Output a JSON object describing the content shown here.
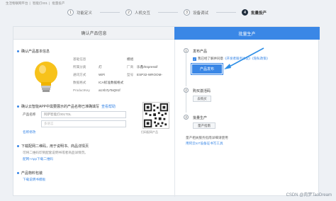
{
  "breadcrumb": [
    "生活物联网平台",
    "智能灯001",
    "批量投产"
  ],
  "steps": [
    {
      "num": "1",
      "label": "功能定义"
    },
    {
      "num": "2",
      "label": "人机交互"
    },
    {
      "num": "3",
      "label": "设备调试"
    },
    {
      "num": "4",
      "label": "批量投产"
    }
  ],
  "left_header": "确认产品信息",
  "right_header": "批量生产",
  "product_section_title": "确认产品基本信息",
  "product_info": [
    {
      "k": "基础信息",
      "v": "模组"
    },
    {
      "k": "所属分类",
      "v": "灯"
    },
    {
      "k": "厂商",
      "v": "乐鑫/Espressif"
    },
    {
      "k": "通讯方式",
      "v": "WiFi"
    },
    {
      "k": "型号",
      "v": "ESP32-WROOM-"
    },
    {
      "k": "数据格式",
      "v": "ICA标准数据格式"
    },
    {
      "k": "ProductKey",
      "v": "a1Xb7pTaQ91f"
    }
  ],
  "app_section": {
    "title": "确认云智能APP中需要展示的产品名称已准确填写",
    "link": "查看帮助",
    "product_name_label": "产品名称",
    "product_name_value": "阿萨智能灯001TDL",
    "subname_placeholder": "多语言",
    "rename_link": "名称修改",
    "qr_label": "扫码配网产品"
  },
  "download_section": {
    "title": "下载配网二维码，用于说明书、商品详情页",
    "desc": "可将二维码印到配套说明书或者商品详情页。",
    "links": "配网+App下载二维码"
  },
  "material_section": {
    "title": "产品物料包装",
    "link": "下载说明书模板"
  },
  "publish": {
    "step_num": "1",
    "title": "发布产品",
    "agree_prefix": "我已经了解并同意",
    "agree_link": "《开发者服务协议》《隐私政策》",
    "button_label": "产品发布"
  },
  "purchase": {
    "step_num": "2",
    "title": "购买激活码",
    "button_label": "去购买"
  },
  "mass_production": {
    "step_num": "3",
    "title": "批量生产",
    "button_label": "量产指南",
    "note_line1": "量产相关服务指南详细请使用",
    "note_link": "用阿云IoT设备证书写工具"
  },
  "watermark": "CSDN @肉梦TaoDream",
  "colors": {
    "accent": "#3a87e6",
    "dark": "#1f2d3d"
  }
}
